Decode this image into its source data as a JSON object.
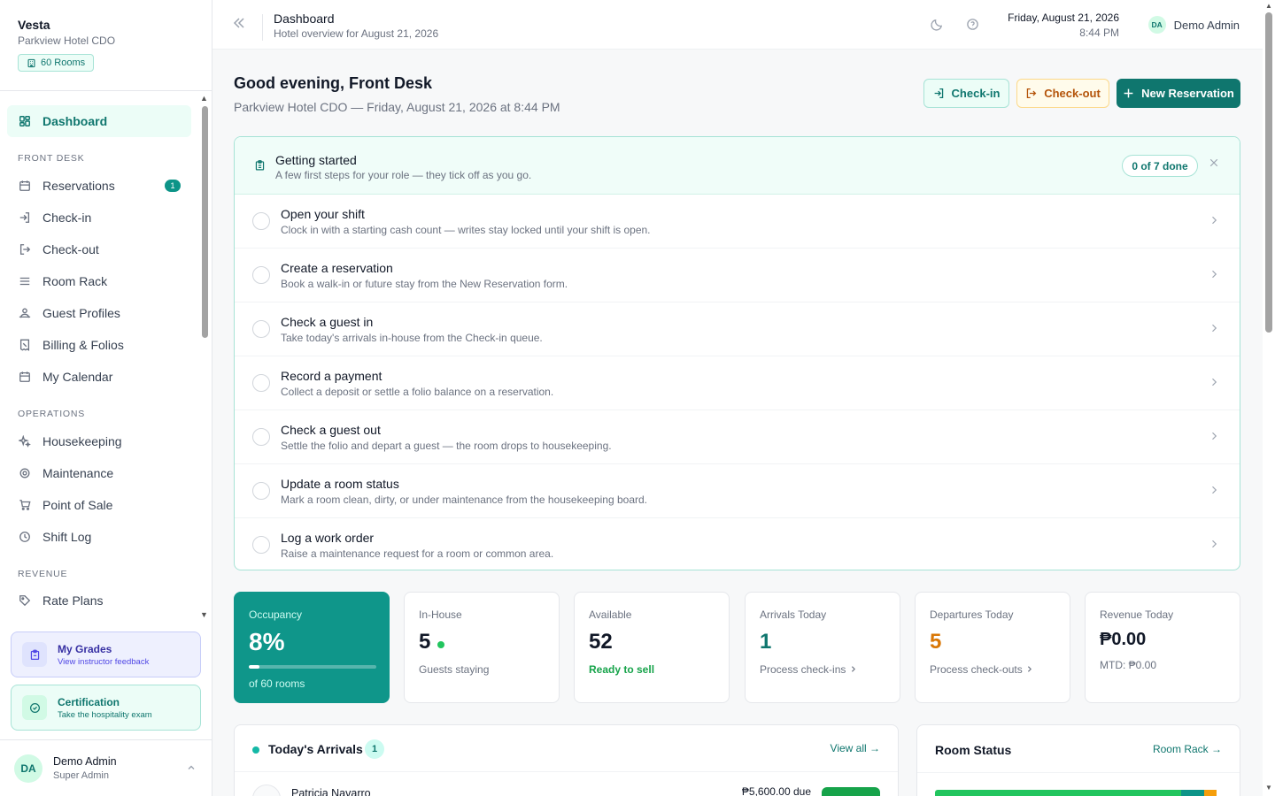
{
  "colors": {
    "accent": "#0f766e",
    "accent_light": "#ecfdf7",
    "amber": "#d97706",
    "success": "#16a34a",
    "indigo": "#4f46e5"
  },
  "brand": {
    "name": "Vesta",
    "subtitle": "Parkview Hotel CDO",
    "rooms_pill": "60 Rooms"
  },
  "sidebar": {
    "active": "Dashboard",
    "dashboard": {
      "label": "Dashboard",
      "icon": "dashboard-grid-icon"
    },
    "sections": {
      "front_desk": "FRONT DESK",
      "operations": "OPERATIONS",
      "revenue": "REVENUE"
    },
    "front_desk_items": [
      {
        "label": "Reservations",
        "icon": "calendar-icon",
        "badge": "1"
      },
      {
        "label": "Check-in",
        "icon": "check-in-icon"
      },
      {
        "label": "Check-out",
        "icon": "check-out-icon"
      },
      {
        "label": "Room Rack",
        "icon": "list-icon"
      },
      {
        "label": "Guest Profiles",
        "icon": "users-icon"
      },
      {
        "label": "Billing & Folios",
        "icon": "receipt-icon"
      },
      {
        "label": "My Calendar",
        "icon": "calendar-icon"
      }
    ],
    "operations_items": [
      {
        "label": "Housekeeping",
        "icon": "sparkle-icon"
      },
      {
        "label": "Maintenance",
        "icon": "gear-icon"
      },
      {
        "label": "Point of Sale",
        "icon": "cart-icon"
      },
      {
        "label": "Shift Log",
        "icon": "clock-icon"
      }
    ],
    "revenue_items": [
      {
        "label": "Rate Plans",
        "icon": "tag-icon"
      }
    ],
    "promos": {
      "grades": {
        "title": "My Grades",
        "subtitle": "View instructor feedback",
        "icon": "clipboard-icon"
      },
      "certification": {
        "title": "Certification",
        "subtitle": "Take the hospitality exam",
        "icon": "badge-check-icon"
      }
    },
    "user": {
      "initials": "DA",
      "name": "Demo Admin",
      "role": "Super Admin"
    }
  },
  "topbar": {
    "title": "Dashboard",
    "subtitle": "Hotel overview for August 21, 2026",
    "date": "Friday, August 21, 2026",
    "time": "8:44 PM",
    "user_initials": "DA",
    "user_name": "Demo Admin"
  },
  "header": {
    "greeting": "Good evening, Front Desk",
    "subline": "Parkview Hotel CDO — Friday, August 21, 2026 at 8:44 PM",
    "buttons": {
      "checkin": "Check-in",
      "checkout": "Check-out",
      "new_reservation": "New Reservation"
    }
  },
  "getting_started": {
    "title": "Getting started",
    "subtitle": "A few first steps for your role — they tick off as you go.",
    "progress": "0 of 7 done",
    "tasks": [
      {
        "title": "Open your shift",
        "desc": "Clock in with a starting cash count — writes stay locked until your shift is open."
      },
      {
        "title": "Create a reservation",
        "desc": "Book a walk-in or future stay from the New Reservation form."
      },
      {
        "title": "Check a guest in",
        "desc": "Take today's arrivals in-house from the Check-in queue."
      },
      {
        "title": "Record a payment",
        "desc": "Collect a deposit or settle a folio balance on a reservation."
      },
      {
        "title": "Check a guest out",
        "desc": "Settle the folio and depart a guest — the room drops to housekeeping."
      },
      {
        "title": "Update a room status",
        "desc": "Mark a room clean, dirty, or under maintenance from the housekeeping board."
      },
      {
        "title": "Log a work order",
        "desc": "Raise a maintenance request for a room or common area."
      }
    ]
  },
  "stats": {
    "occupancy": {
      "label": "Occupancy",
      "value": "8%",
      "fill": 0.08,
      "note": "of 60 rooms"
    },
    "in_house": {
      "label": "In-House",
      "value": "5",
      "note": "Guests staying"
    },
    "available": {
      "label": "Available",
      "value": "52",
      "note": "Ready to sell"
    },
    "arrivals": {
      "label": "Arrivals Today",
      "value": "1",
      "link": "Process check-ins"
    },
    "departures": {
      "label": "Departures Today",
      "value": "5",
      "link": "Process check-outs"
    },
    "revenue": {
      "label": "Revenue Today",
      "value": "₱0.00",
      "note": "MTD: ₱0.00"
    }
  },
  "arrivals": {
    "title": "Today's Arrivals",
    "count": "1",
    "view_all": "View all →",
    "rows": [
      {
        "guest": "Patricia Navarro",
        "due": "₱5,600.00 due"
      }
    ]
  },
  "room_status": {
    "title": "Room Status",
    "link": "Room Rack →"
  }
}
